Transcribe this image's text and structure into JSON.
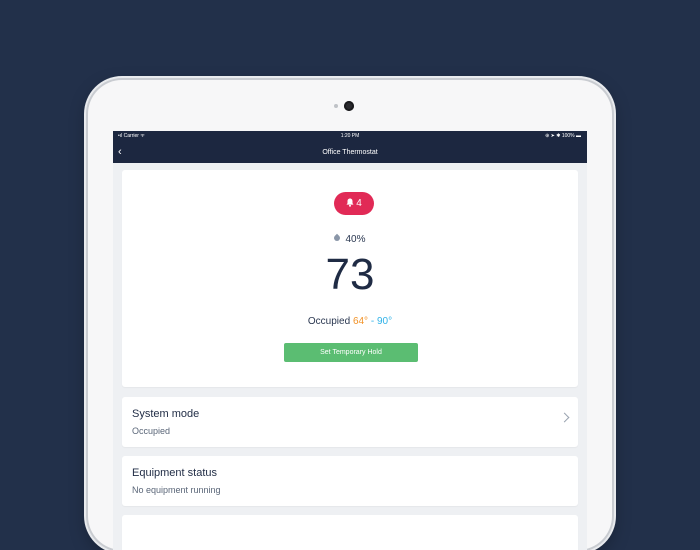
{
  "statusbar": {
    "carrier": "•ıl Carrier ᯤ",
    "time": "1:20 PM",
    "right": "⊕ ➤ ✱ 100% ▬"
  },
  "navbar": {
    "back": "‹",
    "title": "Office Thermostat"
  },
  "thermostat": {
    "alert_count": "4",
    "humidity": "40%",
    "temperature": "73",
    "mode_label": "Occupied",
    "heat_setpoint": "64°",
    "separator": "-",
    "cool_setpoint": "90°",
    "hold_button_label": "Set Temporary Hold",
    "colors": {
      "alert": "#e12a56",
      "heat": "#f29227",
      "cool": "#2fb2e8",
      "button": "#5bbd72"
    }
  },
  "system_mode": {
    "title": "System mode",
    "value": "Occupied"
  },
  "equipment_status": {
    "title": "Equipment status",
    "value": "No equipment running"
  }
}
